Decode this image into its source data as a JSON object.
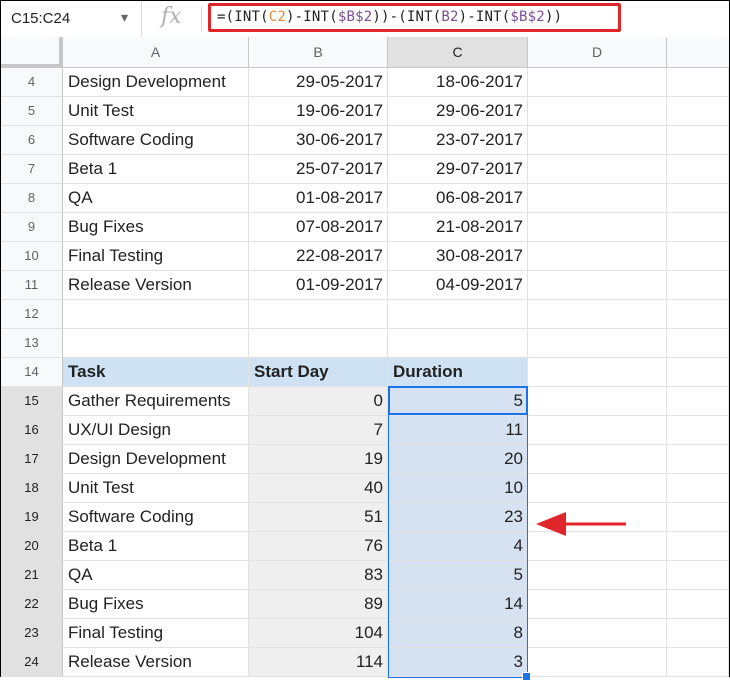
{
  "name_box": {
    "value": "C15:C24"
  },
  "formula_bar": {
    "fx": "fx",
    "parts": [
      "=(INT(",
      "C2",
      ")-INT(",
      "$B$2",
      "))-(INT(",
      "B2",
      ")-INT(",
      "$B$2",
      "))"
    ]
  },
  "columns": [
    "A",
    "B",
    "C",
    "D"
  ],
  "rows": [
    {
      "num": "4",
      "a": "Design Development",
      "b": "29-05-2017",
      "c": "18-06-2017"
    },
    {
      "num": "5",
      "a": "Unit Test",
      "b": "19-06-2017",
      "c": "29-06-2017"
    },
    {
      "num": "6",
      "a": "Software Coding",
      "b": "30-06-2017",
      "c": "23-07-2017"
    },
    {
      "num": "7",
      "a": "Beta 1",
      "b": "25-07-2017",
      "c": "29-07-2017"
    },
    {
      "num": "8",
      "a": "QA",
      "b": "01-08-2017",
      "c": "06-08-2017"
    },
    {
      "num": "9",
      "a": "Bug Fixes",
      "b": "07-08-2017",
      "c": "21-08-2017"
    },
    {
      "num": "10",
      "a": "Final Testing",
      "b": "22-08-2017",
      "c": "30-08-2017"
    },
    {
      "num": "11",
      "a": "Release Version",
      "b": "01-09-2017",
      "c": "04-09-2017"
    },
    {
      "num": "12",
      "a": "",
      "b": "",
      "c": ""
    },
    {
      "num": "13",
      "a": "",
      "b": "",
      "c": ""
    },
    {
      "num": "14",
      "a": "Task",
      "b": "Start Day",
      "c": "Duration"
    },
    {
      "num": "15",
      "a": "Gather Requirements",
      "b": "0",
      "c": "5"
    },
    {
      "num": "16",
      "a": "UX/UI Design",
      "b": "7",
      "c": "11"
    },
    {
      "num": "17",
      "a": "Design Development",
      "b": "19",
      "c": "20"
    },
    {
      "num": "18",
      "a": "Unit Test",
      "b": "40",
      "c": "10"
    },
    {
      "num": "19",
      "a": "Software Coding",
      "b": "51",
      "c": "23"
    },
    {
      "num": "20",
      "a": "Beta 1",
      "b": "76",
      "c": "4"
    },
    {
      "num": "21",
      "a": "QA",
      "b": "83",
      "c": "5"
    },
    {
      "num": "22",
      "a": "Bug Fixes",
      "b": "89",
      "c": "14"
    },
    {
      "num": "23",
      "a": "Final Testing",
      "b": "104",
      "c": "8"
    },
    {
      "num": "24",
      "a": "Release Version",
      "b": "114",
      "c": "3"
    }
  ],
  "colors": {
    "header_fill": "#cfe2f3",
    "selection": "#1a73e8",
    "highlight": "#e0262b"
  }
}
